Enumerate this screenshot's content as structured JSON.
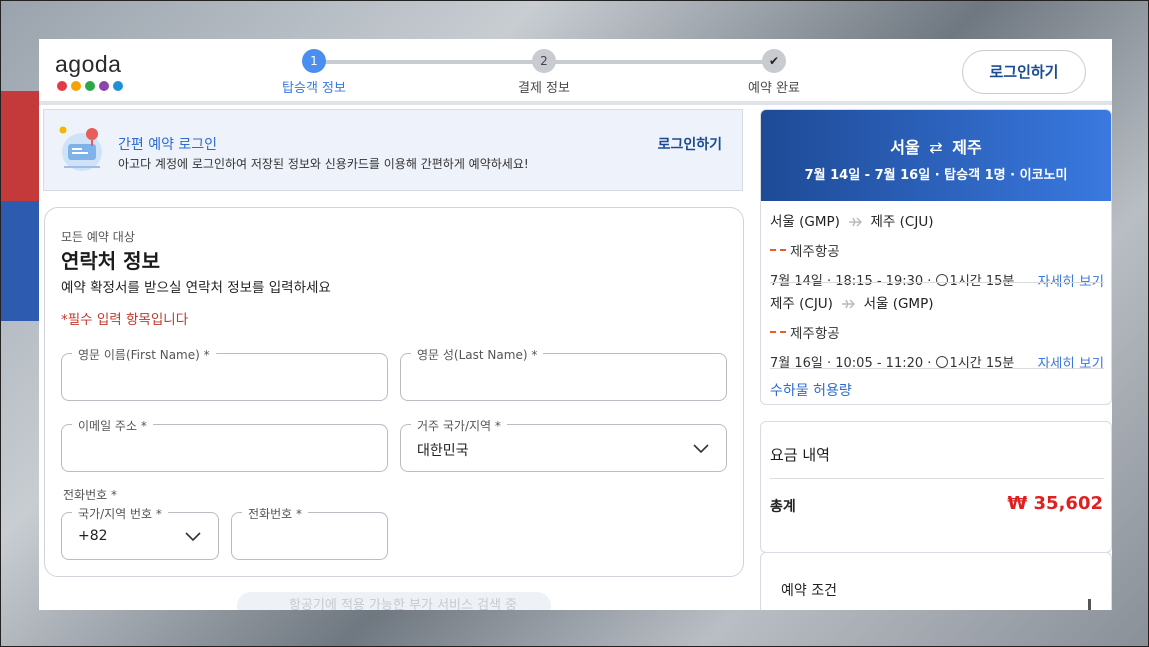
{
  "header": {
    "logo": "agoda",
    "logo_colors": [
      "#e63946",
      "#f4a300",
      "#2ba84a",
      "#8e44ad",
      "#1e90d6"
    ],
    "steps": [
      {
        "number": "1",
        "label": "탑승객 정보",
        "state": "active"
      },
      {
        "number": "2",
        "label": "결제 정보",
        "state": "pending"
      },
      {
        "number": "✔",
        "label": "예약 완료",
        "state": "done"
      }
    ],
    "login_button": "로그인하기"
  },
  "quick_login": {
    "title": "간편 예약 로그인",
    "description": "아고다 계정에 로그인하여 저장된 정보와 신용카드를 이용해 간편하게 예약하세요!",
    "link": "로그인하기"
  },
  "contact": {
    "subtitle": "모든 예약 대상",
    "title": "연락처 정보",
    "description": "예약 확정서를 받으실 연락처 정보를 입력하세요",
    "required_note": "*필수 입력 항목입니다",
    "fields": {
      "first_name": {
        "label": "영문 이름(First Name) *",
        "value": ""
      },
      "last_name": {
        "label": "영문 성(Last Name) *",
        "value": ""
      },
      "email": {
        "label": "이메일 주소 *",
        "value": ""
      },
      "country": {
        "label": "거주 국가/지역 *",
        "value": "대한민국"
      },
      "phone_heading": "전화번호 *",
      "phone_code": {
        "label": "국가/지역 번호 *",
        "value": "+82"
      },
      "phone_number": {
        "label": "전화번호 *",
        "value": ""
      }
    }
  },
  "bottom_notice": "항공기에 적용 가능한 부가 서비스 검색 중",
  "summary": {
    "route_from": "서울",
    "route_to": "제주",
    "route_swap_icon": "⇄",
    "trip_info": "7월 14일 - 7월 16일 · 탑승객 1명 · 이코노미",
    "segments": [
      {
        "from": "서울 (GMP)",
        "to": "제주 (CJU)",
        "airline": "제주항공",
        "times": "7월 14일 · 18:15 - 19:30 · ",
        "duration": "1시간 15분",
        "detail": "자세히 보기"
      },
      {
        "from": "제주 (CJU)",
        "to": "서울 (GMP)",
        "airline": "제주항공",
        "times": "7월 16일 · 10:05 - 11:20 · ",
        "duration": "1시간 15분",
        "detail": "자세히 보기"
      }
    ],
    "baggage": "수하물 허용량"
  },
  "price": {
    "title": "요금 내역",
    "total_label": "총계",
    "total_value": "₩ 35,602"
  },
  "conditions": {
    "title": "예약 조건"
  }
}
